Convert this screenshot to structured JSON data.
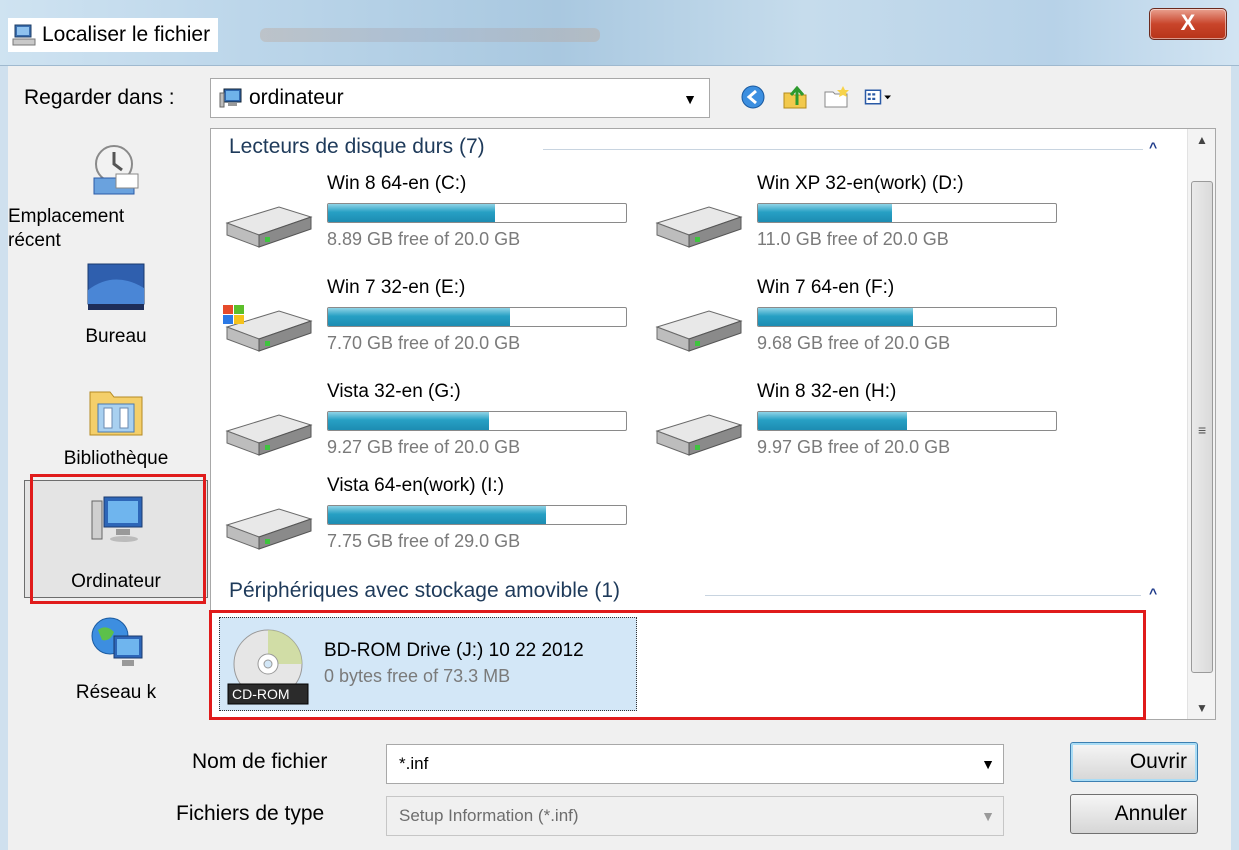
{
  "window": {
    "title": "Localiser le fichier",
    "close_label": "X"
  },
  "lookin": {
    "label": "Regarder dans :",
    "value": "ordinateur"
  },
  "toolbar": {
    "icons": [
      "back-icon",
      "up-folder-icon",
      "new-folder-icon",
      "view-menu-icon"
    ]
  },
  "places": [
    {
      "label": "Emplacement récent",
      "line1": "Emplacement",
      "line2": "récent"
    },
    {
      "label": "Bureau"
    },
    {
      "label": "Bibliothèque"
    },
    {
      "label": "Ordinateur",
      "selected": true
    },
    {
      "label": "Réseau k"
    }
  ],
  "groups": {
    "hard_drives": {
      "header": "Lecteurs de disque durs (7)",
      "drives": [
        {
          "name": "Win 8 64-en (C:)",
          "free": "8.89 GB free of 20.0 GB",
          "used_fraction": 0.56
        },
        {
          "name": "Win XP 32-en(work) (D:)",
          "free": "11.0 GB free of 20.0 GB",
          "used_fraction": 0.45
        },
        {
          "name": "Win 7 32-en (E:)",
          "free": "7.70 GB free of 20.0 GB",
          "used_fraction": 0.61
        },
        {
          "name": "Win 7 64-en (F:)",
          "free": "9.68 GB free of 20.0 GB",
          "used_fraction": 0.52
        },
        {
          "name": "Vista 32-en (G:)",
          "free": "9.27 GB free of 20.0 GB",
          "used_fraction": 0.54
        },
        {
          "name": "Win 8 32-en (H:)",
          "free": "9.97 GB free of 20.0 GB",
          "used_fraction": 0.5
        },
        {
          "name": "Vista 64-en(work) (I:)",
          "free": "7.75 GB free of 29.0 GB",
          "used_fraction": 0.73
        }
      ]
    },
    "removable": {
      "header": "Périphériques avec stockage amovible (1)",
      "device": {
        "name": "BD-ROM Drive (J:) 10 22 2012",
        "free": "0 bytes free of 73.3 MB",
        "badge": "CD-ROM"
      }
    }
  },
  "bottom": {
    "filename_label": "Nom de fichier",
    "filename_value": "*.inf",
    "filetype_label": "Fichiers de type",
    "filetype_value": "Setup Information (*.inf)",
    "open_label": "Ouvrir",
    "cancel_label": "Annuler"
  },
  "colors": {
    "bar_fill": "#27a0c4",
    "highlight_red": "#e01b1b",
    "selected_tile": "#d3e7f7"
  }
}
